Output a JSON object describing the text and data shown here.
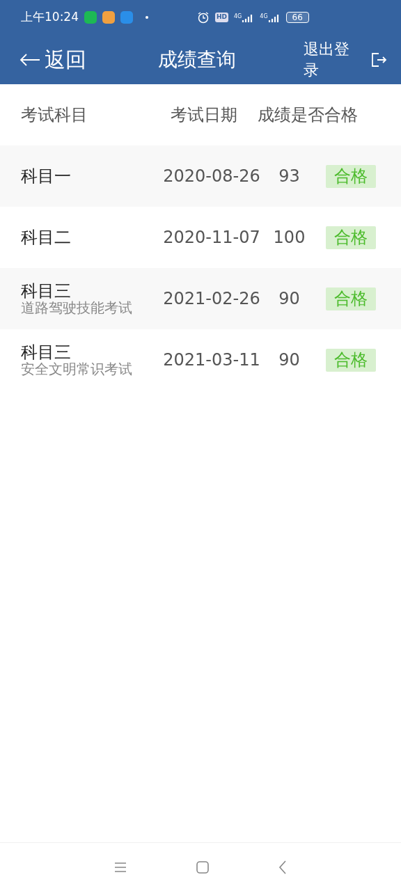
{
  "status_bar": {
    "time": "上午10:24",
    "hd": "HD",
    "networks": [
      "4G",
      "4G"
    ],
    "battery": "66"
  },
  "header": {
    "back": "返回",
    "title": "成绩查询",
    "logout": "退出登录"
  },
  "table": {
    "columns": [
      "考试科目",
      "考试日期",
      "成绩是否合格"
    ],
    "rows": [
      {
        "subject": "科目一",
        "date": "2020-08-26",
        "score": "93",
        "result": "合格"
      },
      {
        "subject": "科目二",
        "date": "2020-11-07",
        "score": "100",
        "result": "合格"
      },
      {
        "subject": "科目三",
        "note": "道路驾驶技能考试",
        "date": "2021-02-26",
        "score": "90",
        "result": "合格"
      },
      {
        "subject": "科目三",
        "note": "安全文明常识考试",
        "date": "2021-03-11",
        "score": "90",
        "result": "合格"
      }
    ]
  }
}
